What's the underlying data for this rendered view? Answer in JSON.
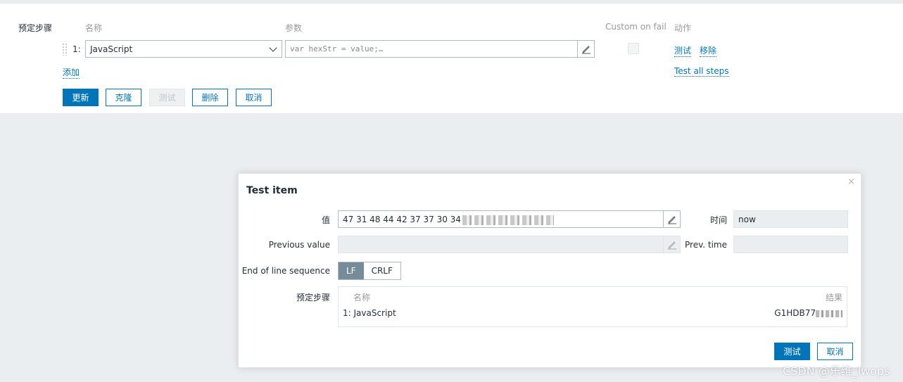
{
  "form": {
    "steps_label": "预定步骤",
    "headers": {
      "name": "名称",
      "params": "参数",
      "custom_on_fail": "Custom on fail",
      "action": "动作"
    },
    "step": {
      "number": "1:",
      "type": "JavaScript",
      "params": "var hexStr = value;…"
    },
    "links": {
      "test": "测试",
      "remove": "移除",
      "add": "添加",
      "test_all": "Test all steps"
    },
    "buttons": {
      "update": "更新",
      "clone": "克隆",
      "test": "测试",
      "delete": "删除",
      "cancel": "取消"
    }
  },
  "modal": {
    "title": "Test item",
    "close": "×",
    "value_label": "值",
    "value": "47 31 48 44 42 37 37 30 34",
    "time_label": "时间",
    "time_value": "now",
    "prev_value_label": "Previous value",
    "prev_time_label": "Prev. time",
    "eol_label": "End of line sequence",
    "eol_options": [
      "LF",
      "CRLF"
    ],
    "eol_selected": "LF",
    "steps_label": "预定步骤",
    "steps_headers": {
      "name": "名称",
      "result": "结果"
    },
    "steps": [
      {
        "name": "1: JavaScript",
        "result": "G1HDB77"
      }
    ],
    "buttons": {
      "test": "测试",
      "cancel": "取消"
    }
  },
  "watermark": "CSDN @乐维_lwops"
}
